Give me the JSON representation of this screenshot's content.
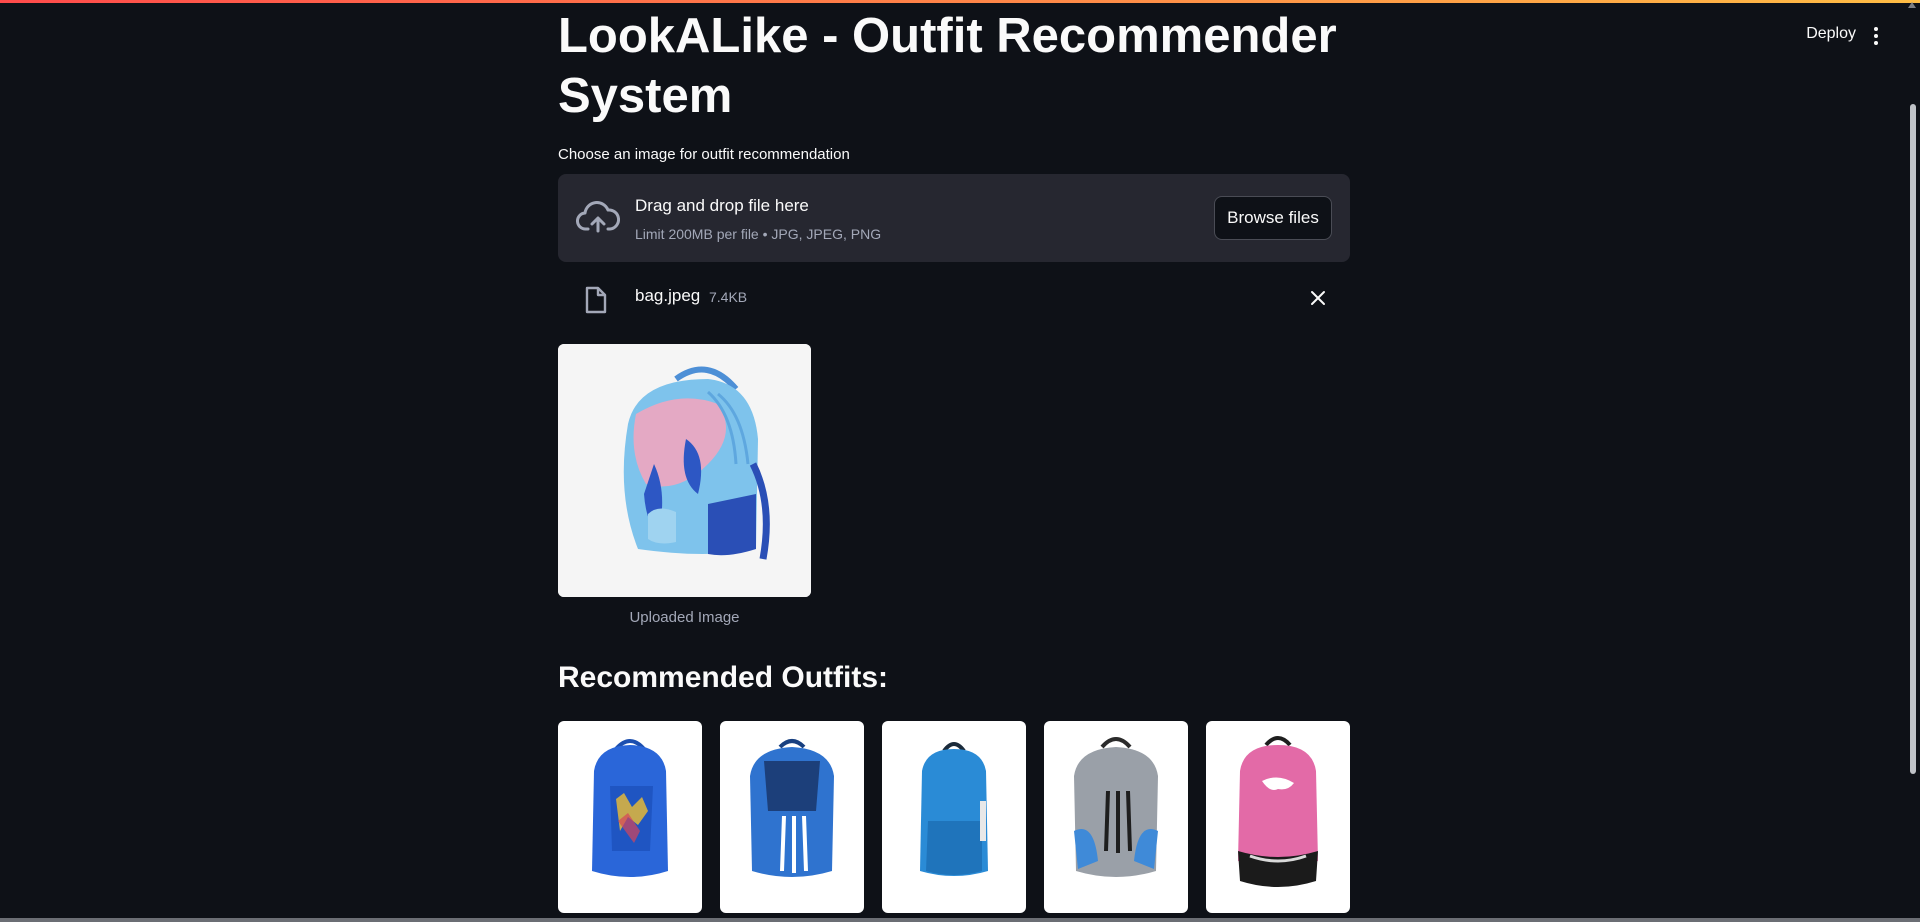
{
  "app": {
    "title": "LookALike - Outfit Recommender System",
    "deploy_label": "Deploy",
    "accent_colors": [
      "#ff4b4b",
      "#ffbd45"
    ],
    "menu_icon": "more-vertical-icon"
  },
  "uploader": {
    "label": "Choose an image for outfit recommendation",
    "drop_title": "Drag and drop file here",
    "drop_sub": "Limit 200MB per file • JPG, JPEG, PNG",
    "browse_label": "Browse files",
    "icon": "cloud-upload-icon"
  },
  "file": {
    "name": "bag.jpeg",
    "size": "7.4KB",
    "icon": "file-icon",
    "remove_icon": "close-icon"
  },
  "uploaded_image": {
    "caption": "Uploaded Image",
    "description_colors": [
      "#7ec3ec",
      "#f0a6c0",
      "#2d57c4"
    ]
  },
  "recommendations": {
    "title": "Recommended Outfits:",
    "items": [
      {
        "color": "#2a66d9"
      },
      {
        "color": "#2f73cf"
      },
      {
        "color": "#2a8bd6"
      },
      {
        "color": "#9aa0a8"
      },
      {
        "color": "#e36aa7"
      }
    ]
  }
}
